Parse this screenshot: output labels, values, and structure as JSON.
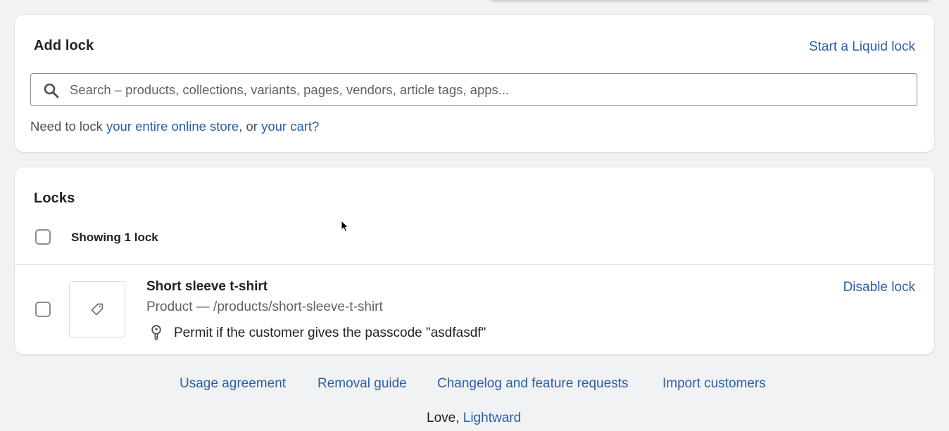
{
  "add_lock": {
    "title": "Add lock",
    "start_liquid_lock_link": "Start a Liquid lock",
    "search": {
      "placeholder": "Search – products, collections, variants, pages, vendors, article tags, apps...",
      "value": ""
    },
    "help": {
      "prefix": "Need to lock ",
      "store_link": "your entire online store",
      "middle": ", or ",
      "cart_link": "your cart",
      "suffix": "?"
    }
  },
  "locks": {
    "title": "Locks",
    "showing_label": "Showing 1 lock",
    "items": [
      {
        "title": "Short sleeve t-shirt",
        "path": "Product — /products/short-sleeve-t-shirt",
        "rule": "Permit if the customer gives the passcode \"asdfasdf\"",
        "action": "Disable lock",
        "thumbnail_icon": "tag-icon",
        "rule_icon": "key-icon"
      }
    ]
  },
  "footer": {
    "links": [
      "Usage agreement",
      "Removal guide",
      "Changelog and feature requests",
      "Import customers"
    ],
    "love_prefix": "Love, ",
    "love_link": "Lightward"
  },
  "colors": {
    "link": "#2b5fa6",
    "background": "#f1f2f4",
    "card": "#ffffff",
    "border": "#8a8d91"
  }
}
